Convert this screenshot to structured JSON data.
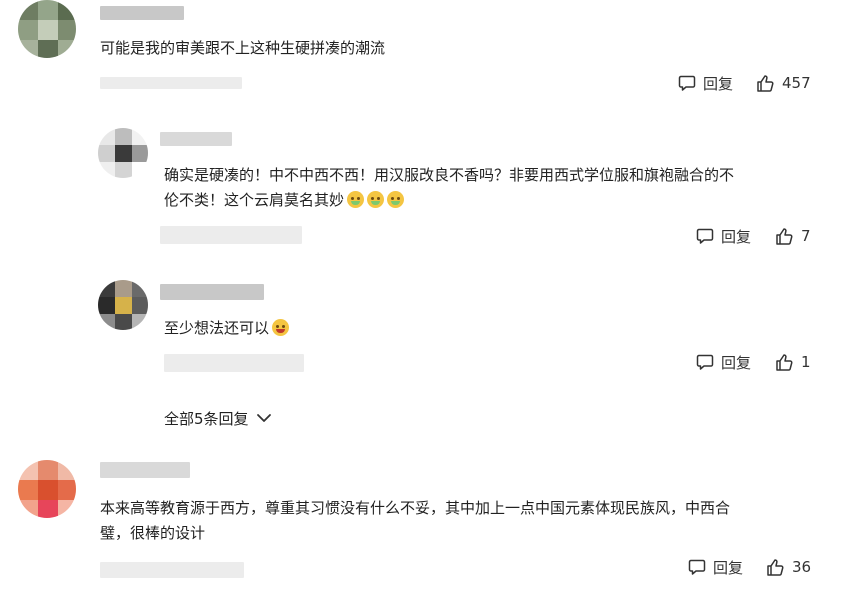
{
  "comments": [
    {
      "text": "可能是我的审美跟不上这种生硬拼凑的潮流",
      "reply_label": "回复",
      "likes": "457"
    },
    {
      "text_line1": "确实是硬凑的！中不中西不西！用汉服改良不香吗？非要用西式学位服和旗袍融合的不",
      "text_line2": "伦不类！这个云肩莫名其妙",
      "emoji": "vomit-emoji",
      "reply_label": "回复",
      "likes": "7"
    },
    {
      "text": "至少想法还可以",
      "emoji": "laughing-emoji",
      "reply_label": "回复",
      "likes": "1"
    },
    {
      "text_line1": "本来高等教育源于西方，尊重其习惯没有什么不妥，其中加上一点中国元素体现民族风，中西合",
      "text_line2": "璧，很棒的设计",
      "reply_label": "回复",
      "likes": "36"
    }
  ],
  "show_all_replies": "全部5条回复",
  "icons": {
    "reply": "comment-bubble-icon",
    "like": "thumbs-up-icon",
    "expand": "chevron-down-icon"
  },
  "colors": {
    "text": "#222222",
    "action": "#333333",
    "background": "#ffffff"
  }
}
